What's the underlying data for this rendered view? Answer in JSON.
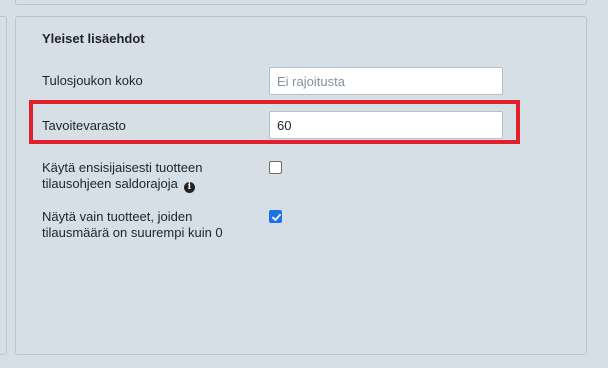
{
  "panel": {
    "title": "Yleiset lisäehdot"
  },
  "fields": {
    "result_set_size": {
      "label": "Tulosjoukon koko",
      "value": "",
      "placeholder": "Ei rajoitusta"
    },
    "target_stock": {
      "label": "Tavoitevarasto",
      "value": "60",
      "placeholder": ""
    }
  },
  "options": {
    "prefer_order_guide_balance_limits": {
      "label_line1": "Käytä ensisijaisesti tuotteen",
      "label_line2": "tilausohjeen saldorajoja",
      "checked": false,
      "info_icon": "info-circle-icon"
    },
    "show_only_qty_gt_zero": {
      "label_line1": "Näytä vain tuotteet, joiden",
      "label_line2": "tilausmäärä on suurempi kuin 0",
      "checked": true
    }
  },
  "colors": {
    "background": "#d6dfe6",
    "highlight": "#e0202c",
    "checkbox_checked": "#1a73e8"
  }
}
